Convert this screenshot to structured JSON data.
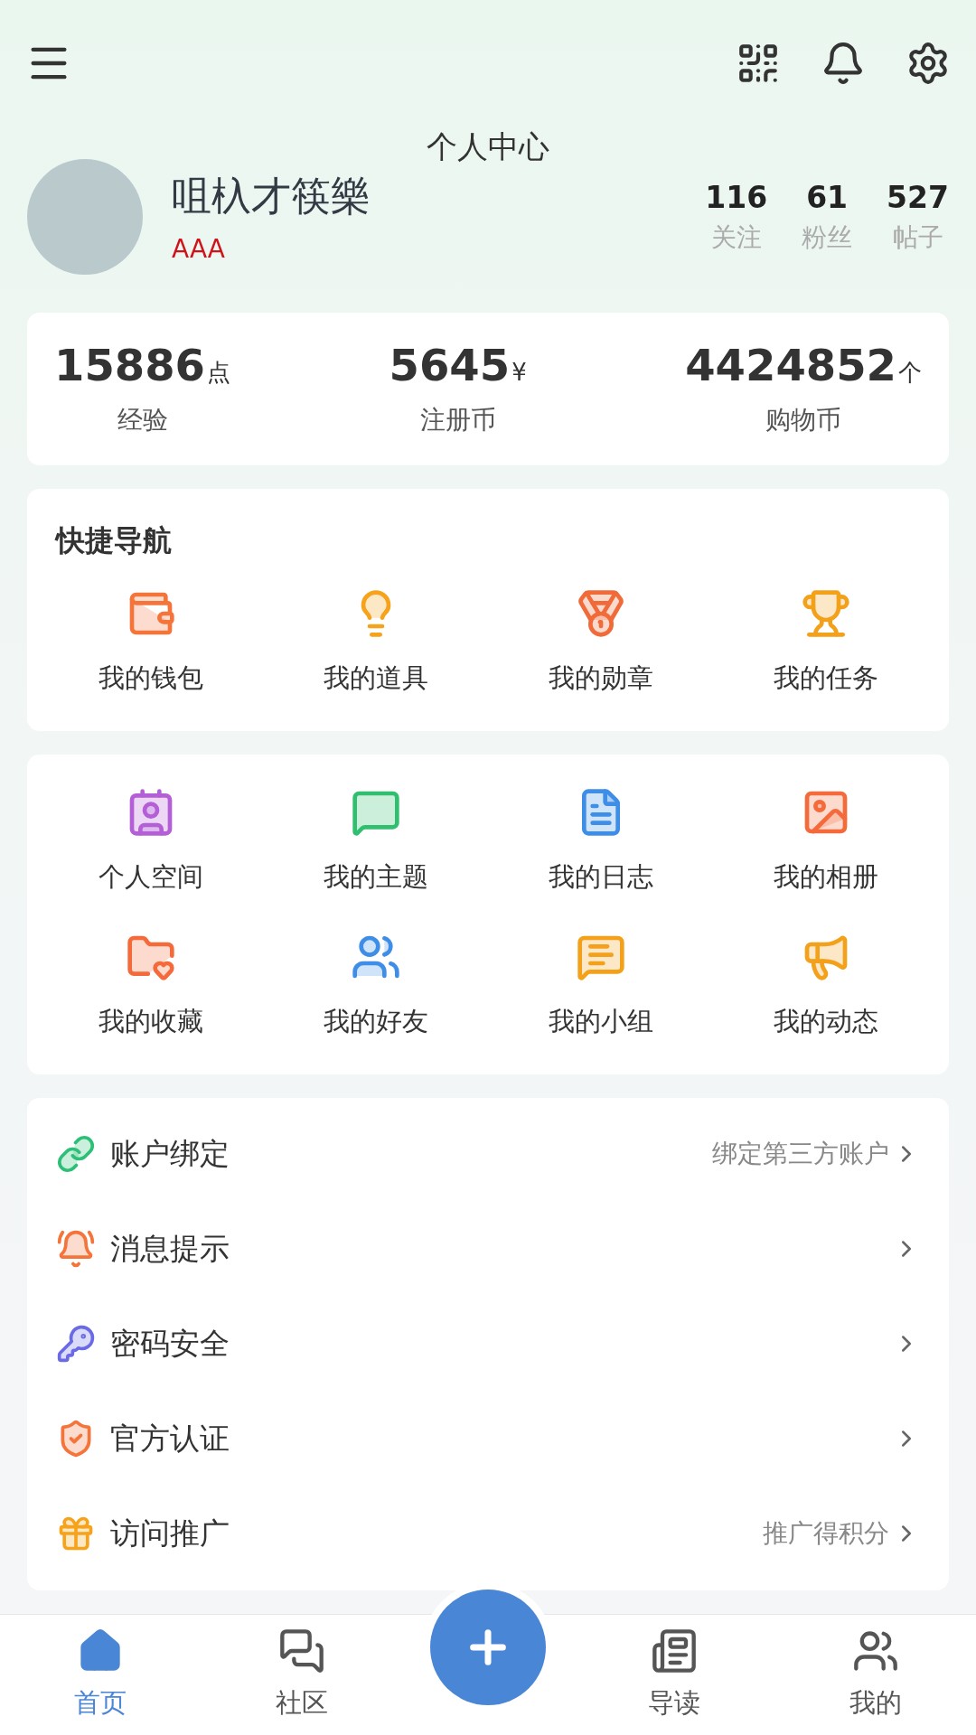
{
  "header": {
    "title": "个人中心"
  },
  "profile": {
    "name": "咀杁才筷樂",
    "level_text": "AAA",
    "counts": [
      {
        "value": "116",
        "label": "关注"
      },
      {
        "value": "61",
        "label": "粉丝"
      },
      {
        "value": "527",
        "label": "帖子"
      }
    ]
  },
  "wallet_stats": [
    {
      "value": "15886",
      "unit": "点",
      "label": "经验"
    },
    {
      "value": "5645",
      "unit": "¥",
      "label": "注册币"
    },
    {
      "value": "4424852",
      "unit": "个",
      "label": "购物币"
    }
  ],
  "quick_nav": {
    "title": "快捷导航",
    "items": [
      "我的钱包",
      "我的道具",
      "我的勋章",
      "我的任务"
    ]
  },
  "features": [
    "个人空间",
    "我的主题",
    "我的日志",
    "我的相册",
    "我的收藏",
    "我的好友",
    "我的小组",
    "我的动态"
  ],
  "settings": [
    {
      "label": "账户绑定",
      "hint": "绑定第三方账户"
    },
    {
      "label": "消息提示"
    },
    {
      "label": "密码安全"
    },
    {
      "label": "官方认证"
    },
    {
      "label": "访问推广",
      "hint": "推广得积分"
    }
  ],
  "bottom_nav": [
    {
      "label": "首页",
      "selected": true
    },
    {
      "label": "社区",
      "selected": false
    },
    {
      "label": "导读",
      "selected": false
    },
    {
      "label": "我的",
      "selected": false
    }
  ]
}
